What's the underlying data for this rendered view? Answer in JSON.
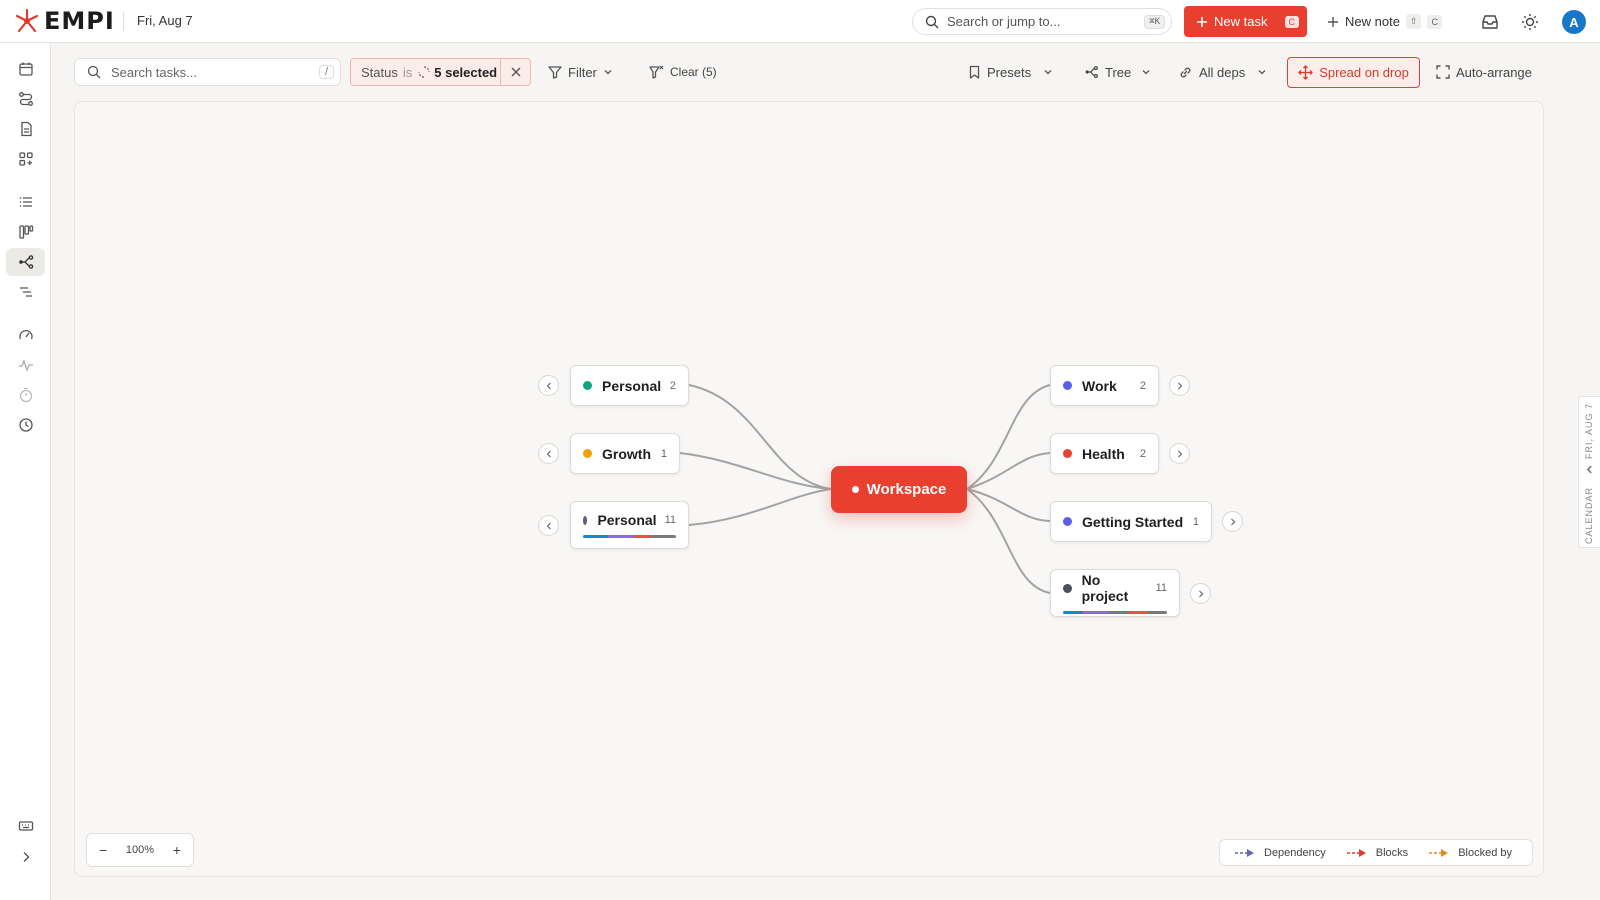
{
  "app": {
    "name": "EMPI",
    "date": "Fri, Aug 7"
  },
  "topbar": {
    "search_placeholder": "Search or jump to...",
    "search_shortcut": "⌘K",
    "new_task_label": "New task",
    "new_task_shortcut": "C",
    "new_note_label": "New note",
    "new_note_shortcut_1": "⇧",
    "new_note_shortcut_2": "C",
    "avatar_initial": "A"
  },
  "sidebar": {
    "items": [
      {
        "name": "calendar-icon"
      },
      {
        "name": "routes-icon"
      },
      {
        "name": "notes-icon"
      },
      {
        "name": "apps-icon"
      },
      {
        "name": "list-icon"
      },
      {
        "name": "board-icon"
      },
      {
        "name": "tree-view-icon",
        "active": true
      },
      {
        "name": "outline-icon"
      },
      {
        "name": "gauge-icon"
      },
      {
        "name": "activity-icon"
      },
      {
        "name": "timer-icon"
      },
      {
        "name": "clock-icon"
      }
    ]
  },
  "toolbar": {
    "search_placeholder": "Search tasks...",
    "search_shortcut": "/",
    "status_field": "Status",
    "status_operator": "is",
    "status_value": "5 selected",
    "filter_label": "Filter",
    "clear_label": "Clear (5)",
    "presets_label": "Presets",
    "view_label": "Tree",
    "deps_label": "All deps",
    "spread_label": "Spread on drop",
    "auto_arrange_label": "Auto-arrange"
  },
  "graph": {
    "root": {
      "label": "Workspace"
    },
    "left_nodes": [
      {
        "label": "Personal",
        "count": "2",
        "color": "#13a37a"
      },
      {
        "label": "Growth",
        "count": "1",
        "color": "#f0a008"
      },
      {
        "label": "Personal",
        "count": "11",
        "color": "#5b6378",
        "progress": true
      }
    ],
    "right_nodes": [
      {
        "label": "Work",
        "count": "2",
        "color": "#5b5fe8"
      },
      {
        "label": "Health",
        "count": "2",
        "color": "#e83f2e"
      },
      {
        "label": "Getting Started",
        "count": "1",
        "color": "#5b5fe8"
      },
      {
        "label": "No project",
        "count": "11",
        "color": "#4a4f5a",
        "progress": true
      }
    ],
    "progress_colors": [
      "#1a86c7",
      "#8a6bd8",
      "#e0564a",
      "#7a7a7a"
    ]
  },
  "zoom": {
    "minus": "−",
    "value": "100%",
    "plus": "+"
  },
  "legend": {
    "dependency": "Dependency",
    "blocks": "Blocks",
    "blocked_by": "Blocked by",
    "colors": {
      "dependency": "#6366b8",
      "blocks": "#e23b30",
      "blocked_by": "#e08a20"
    }
  },
  "right_panel": {
    "date_label": "FRI, AUG 7",
    "title": "CALENDAR"
  }
}
